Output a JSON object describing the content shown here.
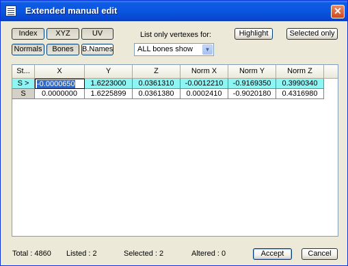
{
  "window": {
    "title": "Extended manual edit",
    "close_glyph": "✕"
  },
  "toolbar": {
    "index": "Index",
    "xyz": "XYZ",
    "uv": "UV",
    "normals": "Normals",
    "bones": "Bones",
    "bnames": "B.Names",
    "list_label": "List only vertexes for:",
    "bones_filter": "ALL bones show",
    "highlight": "Highlight",
    "selected_only": "Selected only"
  },
  "table": {
    "columns": [
      "St...",
      "X",
      "Y",
      "Z",
      "Norm X",
      "Norm Y",
      "Norm Z"
    ],
    "rows": [
      {
        "status": "S >",
        "selected": true,
        "cells": [
          "-0.0000650",
          "1.6223000",
          "0.0361310",
          "-0.0012210",
          "-0.9169350",
          "0.3990340"
        ]
      },
      {
        "status": "S",
        "selected": false,
        "cells": [
          "0.0000000",
          "1.6225899",
          "0.0361380",
          "0.0002410",
          "-0.9020180",
          "0.4316980"
        ]
      }
    ]
  },
  "status": {
    "total": "Total : 4860",
    "listed": "Listed : 2",
    "selected": "Selected : 2",
    "altered": "Altered : 0"
  },
  "buttons": {
    "accept": "Accept",
    "cancel": "Cancel"
  },
  "colors": {
    "title_bar": "#0a56e0",
    "selected_row": "#8ff4f4",
    "dialog_bg": "#ece9d8"
  }
}
